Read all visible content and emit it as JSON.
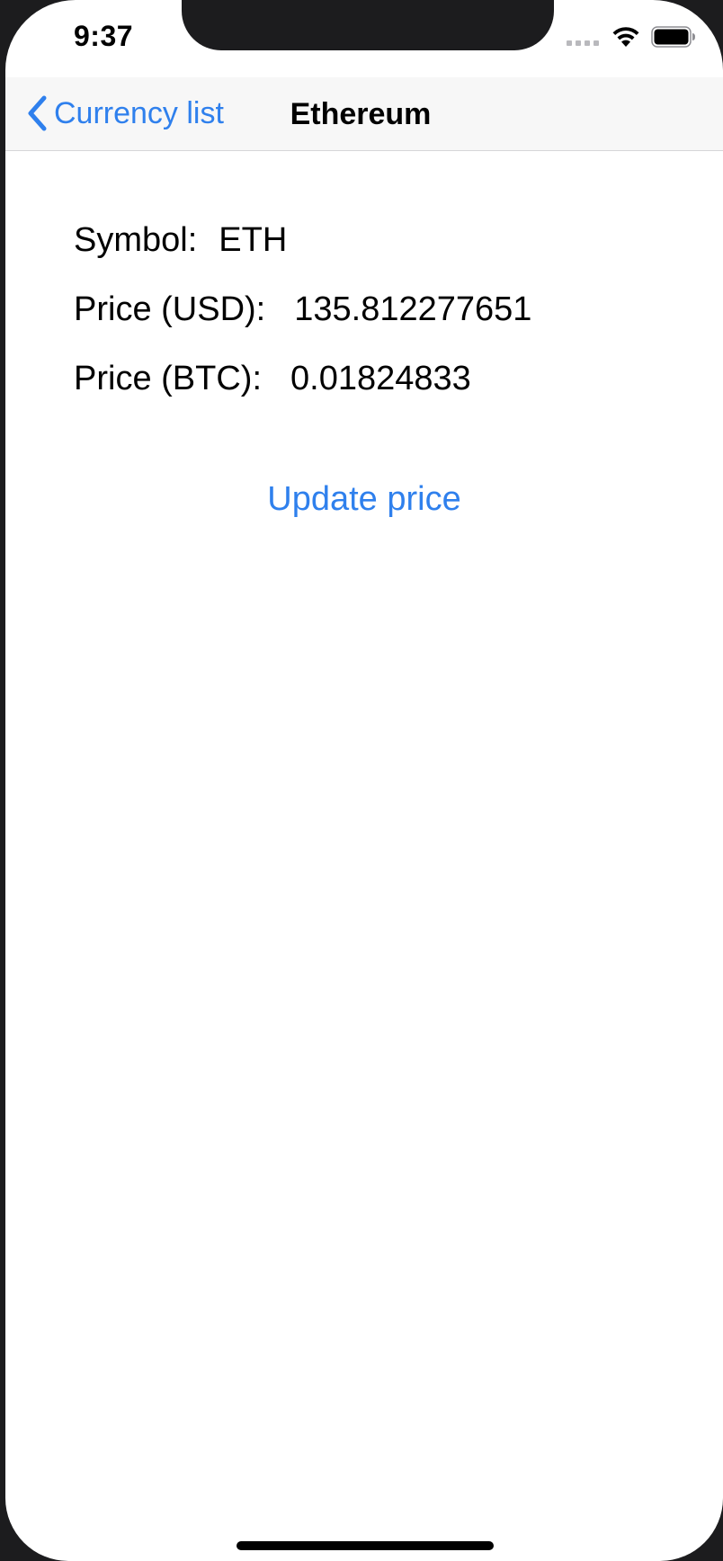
{
  "status_bar": {
    "time": "9:37",
    "icons": [
      "cellular-signal-icon",
      "wifi-icon",
      "battery-icon"
    ]
  },
  "nav_bar": {
    "back_label": "Currency list",
    "back_icon": "chevron-left-icon",
    "title": "Ethereum"
  },
  "details": {
    "symbol_label": "Symbol:",
    "symbol_value": "ETH",
    "price_usd_label": "Price (USD):",
    "price_usd_value": "135.812277651",
    "price_btc_label": "Price (BTC):",
    "price_btc_value": "0.01824833"
  },
  "actions": {
    "update_label": "Update price"
  },
  "colors": {
    "accent": "#2f80ed",
    "nav_background": "#f7f7f7",
    "text": "#000000"
  }
}
